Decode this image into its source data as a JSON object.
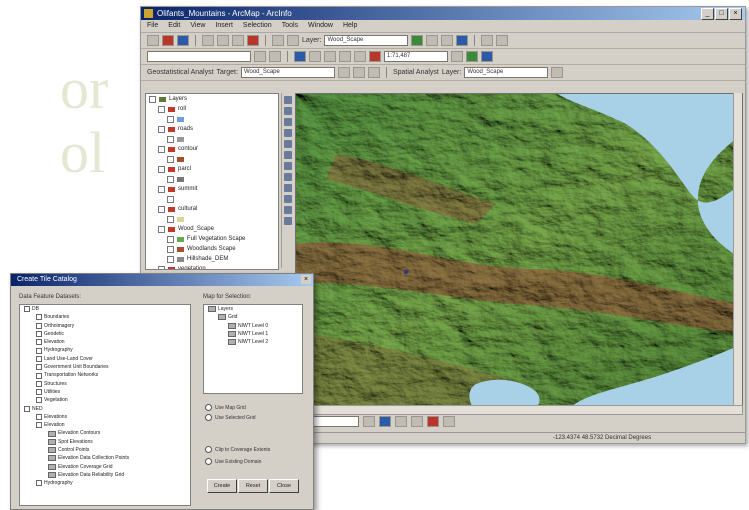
{
  "background_text": [
    "or",
    "ol"
  ],
  "app": {
    "title": "Olifants_Mountains - ArcMap - ArcInfo",
    "window_buttons": [
      "_",
      "□",
      "×"
    ],
    "menu": [
      "File",
      "Edit",
      "View",
      "Insert",
      "Selection",
      "Tools",
      "Window",
      "Help"
    ],
    "layer_label": "Layer:",
    "layer_value": "Wood_Scape",
    "scale_value": "1:71,487",
    "editor_label": "Geostatistical Analyst",
    "target_label": "Target:",
    "target_value": "Wood_Scape",
    "analysis_label": "Spatial Analyst",
    "analysis_layer_label": "Layer:",
    "analysis_layer_value": "Wood_Scape",
    "status_coords": "-123.4374  48.5732 Decimal Degrees",
    "toc": [
      {
        "label": "Layers",
        "swatch": "#5a7a3a",
        "indent": 0
      },
      {
        "label": "roll",
        "swatch": "#c0392b",
        "indent": 1
      },
      {
        "label": "",
        "swatch": "#6f9fd8",
        "indent": 2
      },
      {
        "label": "roads",
        "swatch": "#c0392b",
        "indent": 1
      },
      {
        "label": "",
        "swatch": "#999999",
        "indent": 2
      },
      {
        "label": "contour",
        "swatch": "#c0392b",
        "indent": 1
      },
      {
        "label": "",
        "swatch": "#a0522d",
        "indent": 2
      },
      {
        "label": "parcl",
        "swatch": "#c0392b",
        "indent": 1
      },
      {
        "label": "",
        "swatch": "#777777",
        "indent": 2
      },
      {
        "label": "summit",
        "swatch": "#c0392b",
        "indent": 1
      },
      {
        "label": "",
        "swatch": "",
        "indent": 2
      },
      {
        "label": "cultural",
        "swatch": "#c0392b",
        "indent": 1
      },
      {
        "label": "",
        "swatch": "#ddd39a",
        "indent": 2
      },
      {
        "label": "Wood_Scape",
        "swatch": "#c0392b",
        "indent": 1
      },
      {
        "label": "Full Vegetation Scape",
        "swatch": "#6aa84f",
        "indent": 2
      },
      {
        "label": "Woodlands Scape",
        "swatch": "#a0522d",
        "indent": 2
      },
      {
        "label": "Hillshade_DEM",
        "swatch": "#888888",
        "indent": 2
      },
      {
        "label": "vegetation",
        "swatch": "#c0392b",
        "indent": 1
      }
    ]
  },
  "dialog": {
    "title": "Create Tile Catalog",
    "close": "×",
    "left_label": "Data Feature Datasets:",
    "right_label": "Map for Selection:",
    "left_tree": [
      {
        "label": "DB",
        "indent": 0,
        "type": "ck"
      },
      {
        "label": "Boundaries",
        "indent": 1,
        "type": "ck"
      },
      {
        "label": "Orthoimagery",
        "indent": 1,
        "type": "ck"
      },
      {
        "label": "Geodetic",
        "indent": 1,
        "type": "ck"
      },
      {
        "label": "Elevation",
        "indent": 1,
        "type": "ck"
      },
      {
        "label": "Hydrography",
        "indent": 1,
        "type": "ck"
      },
      {
        "label": "Land Use-Land Cover",
        "indent": 1,
        "type": "ck"
      },
      {
        "label": "Government Unit Boundaries",
        "indent": 1,
        "type": "ck"
      },
      {
        "label": "Transportation Networks",
        "indent": 1,
        "type": "ck"
      },
      {
        "label": "Structures",
        "indent": 1,
        "type": "ck"
      },
      {
        "label": "Utilities",
        "indent": 1,
        "type": "ck"
      },
      {
        "label": "Vegetation",
        "indent": 1,
        "type": "ck"
      },
      {
        "label": "NED",
        "indent": 0,
        "type": "ck"
      },
      {
        "label": "Elevations",
        "indent": 1,
        "type": "ck"
      },
      {
        "label": "Elevation",
        "indent": 1,
        "type": "ck"
      },
      {
        "label": "Elevation Contours",
        "indent": 2,
        "type": "fi"
      },
      {
        "label": "Spot Elevations",
        "indent": 2,
        "type": "fi"
      },
      {
        "label": "Control Points",
        "indent": 2,
        "type": "fi"
      },
      {
        "label": "Elevation Data Collection Points",
        "indent": 2,
        "type": "fi"
      },
      {
        "label": "Elevation Coverage Grid",
        "indent": 2,
        "type": "fi"
      },
      {
        "label": "Elevation Data Reliability Grid",
        "indent": 2,
        "type": "fi"
      },
      {
        "label": "Hydrography",
        "indent": 1,
        "type": "ck"
      }
    ],
    "right_tree": [
      {
        "label": "Layers",
        "indent": 0
      },
      {
        "label": "Grid",
        "indent": 1
      },
      {
        "label": "NIWT Level 0",
        "indent": 2
      },
      {
        "label": "NIWT Level 1",
        "indent": 2
      },
      {
        "label": "NIWT Level 2",
        "indent": 2
      }
    ],
    "radio_1": "Use Map Grid",
    "radio_2": "Use Selected Grid",
    "radio_3": "Clip to Coverage Extents",
    "radio_4": "Use Existing Domain",
    "buttons": [
      "Create",
      "Reset",
      "Close"
    ]
  }
}
